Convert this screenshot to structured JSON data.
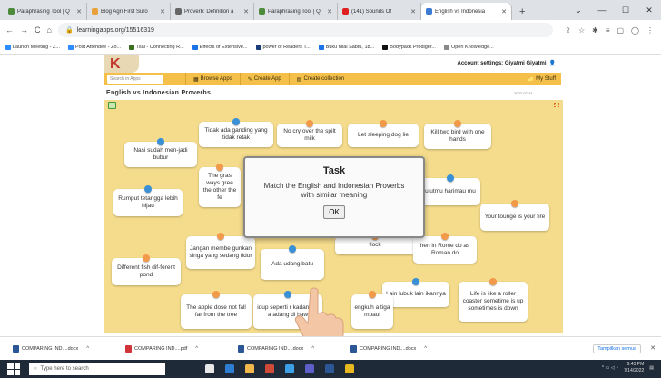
{
  "browser": {
    "tabs": [
      {
        "label": "Paraphrasing Tool | Q",
        "color": "#4b8b3b",
        "active": false
      },
      {
        "label": "Blog Agri First Suro",
        "color": "#e9a13b",
        "active": false
      },
      {
        "label": "Proverb: Definition a",
        "color": "#666666",
        "active": false
      },
      {
        "label": "Paraphrasing Tool | Q",
        "color": "#4b8b3b",
        "active": false
      },
      {
        "label": "(141) Sounds Of ",
        "color": "#e02020",
        "active": false
      },
      {
        "label": "English vs Indonesia",
        "color": "#3b7bd4",
        "active": true
      }
    ],
    "url": "learningapps.org/15516319",
    "bookmarks": [
      {
        "label": "Launch Meeting - Z...",
        "color": "#2d8cff"
      },
      {
        "label": "Post Attendee - Zo...",
        "color": "#2d8cff"
      },
      {
        "label": "Tsai - Connecting R...",
        "color": "#3b6e1f"
      },
      {
        "label": "Effects of Extensive...",
        "color": "#1a73e8"
      },
      {
        "label": "power of Readers T...",
        "color": "#1a3d7a"
      },
      {
        "label": "Buku nilai Sabtu, 18...",
        "color": "#1a73e8"
      },
      {
        "label": "Bodypack Prodiger...",
        "color": "#111111"
      },
      {
        "label": "Open Knowledge...",
        "color": "#888888"
      }
    ]
  },
  "app": {
    "account": "Account settings: Giyatmi Giyatmi",
    "search_placeholder": "Search in Apps",
    "menu": [
      "Browse Apps",
      "Create App",
      "Create collection"
    ],
    "my_stuff": "My Stuff",
    "title": "English vs Indonesian Proverbs",
    "date": "2022-07-14"
  },
  "cards": [
    {
      "text": "Tidak ada ganding yang tidak retak",
      "pin": "blue"
    },
    {
      "text": "No cry over the spilt milk",
      "pin": "orange"
    },
    {
      "text": "Let sleeping dog lie",
      "pin": "orange"
    },
    {
      "text": "Kill two bird with one hands",
      "pin": "orange"
    },
    {
      "text": "Nasi sudah men-jadi bubur",
      "pin": "blue"
    },
    {
      "text": "The gras ways gree the other the fe",
      "pin": "orange"
    },
    {
      "text": "ulutmu harimau mu",
      "pin": "blue"
    },
    {
      "text": "Rumput tetangga lebih hijau",
      "pin": "blue"
    },
    {
      "text": "Your tounge is your fire",
      "pin": "orange"
    },
    {
      "text": "Jangan membe gunkan singa yang sedang tidur",
      "pin": "orange"
    },
    {
      "text": "Ada udang batu",
      "pin": "blue"
    },
    {
      "text": "flock",
      "pin": "orange"
    },
    {
      "text": "hen in Rome do as Roman do",
      "pin": "orange"
    },
    {
      "text": "Different fish dif-ferent pond",
      "pin": "orange"
    },
    {
      "text": "Lain lubuk lain ikannya",
      "pin": "blue"
    },
    {
      "text": "Life is like a roller coaster sometime is up sometimes is down",
      "pin": "orange"
    },
    {
      "text": "The apple dose not fall far from the tree",
      "pin": "orange"
    },
    {
      "text": "idup seperti r kadang di a adang di baw",
      "pin": "blue"
    },
    {
      "text": "engkuh a tiga mpaui",
      "pin": "orange"
    }
  ],
  "dialog": {
    "title": "Task",
    "message": "Match the English and Indonesian Proverbs with similar meaning",
    "ok": "OK"
  },
  "downloads": [
    {
      "label": "COMPARING IND....docx",
      "color": "#2b5797"
    },
    {
      "label": "COMPARING IND....pdf",
      "color": "#d13438"
    },
    {
      "label": "COMPARING IND....docx",
      "color": "#2b5797"
    },
    {
      "label": "COMPARING IND....docx",
      "color": "#2b5797"
    }
  ],
  "downloads_show_all": "Tampilkan semua",
  "taskbar": {
    "search": "Type here to search",
    "time": "9:43 PM",
    "date": "7/14/2022",
    "icons": [
      "#e8e8e8",
      "#2d7dd2",
      "#f2b84b",
      "#d04a3a",
      "#3ba0e6",
      "#5b5fc7",
      "#2b5797",
      "#e8b820"
    ]
  }
}
